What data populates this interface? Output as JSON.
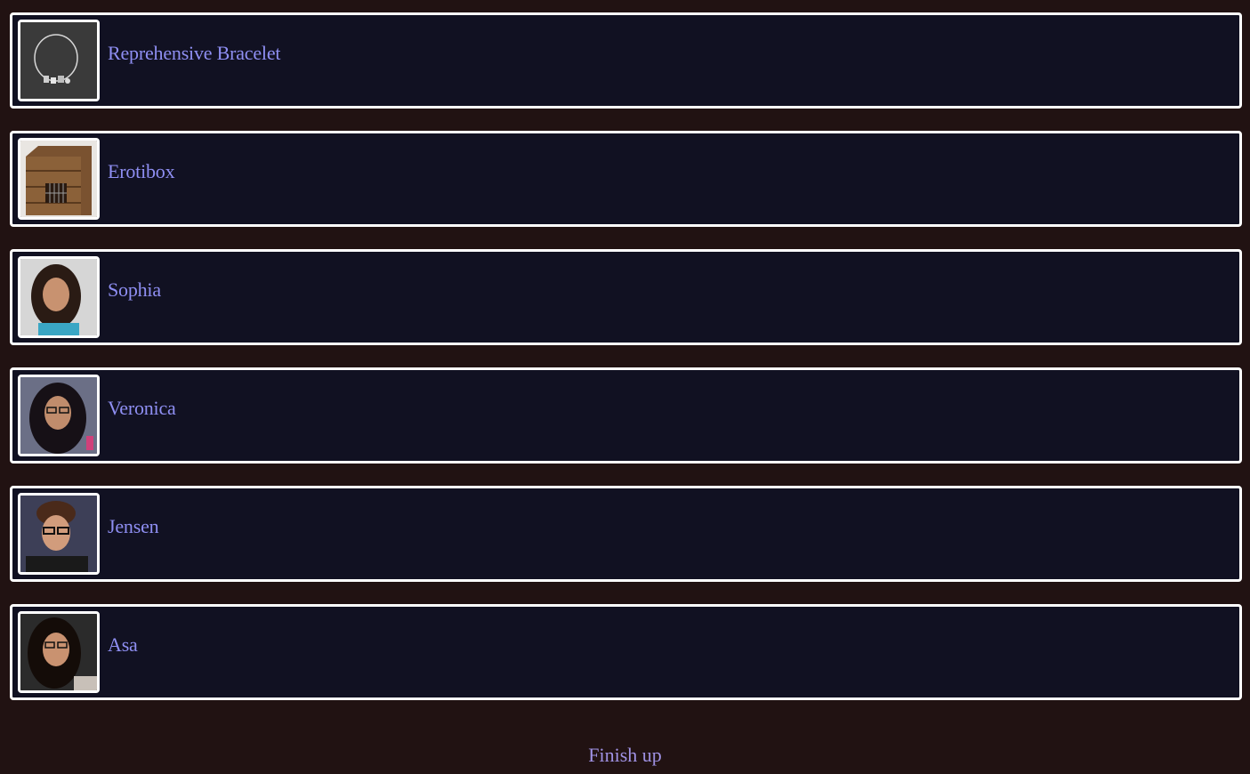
{
  "items": [
    {
      "label": "Reprehensive Bracelet",
      "image": "bracelet-photo"
    },
    {
      "label": "Erotibox",
      "image": "wooden-crate-photo"
    },
    {
      "label": "Sophia",
      "image": "portrait-photo"
    },
    {
      "label": "Veronica",
      "image": "portrait-photo"
    },
    {
      "label": "Jensen",
      "image": "portrait-photo"
    },
    {
      "label": "Asa",
      "image": "portrait-photo"
    }
  ],
  "finish_label": "Finish up",
  "colors": {
    "background": "#211212",
    "card_background": "#111122",
    "card_border": "#ffffff",
    "label_text": "#8f8ff3",
    "finish_text": "#a092e4"
  }
}
